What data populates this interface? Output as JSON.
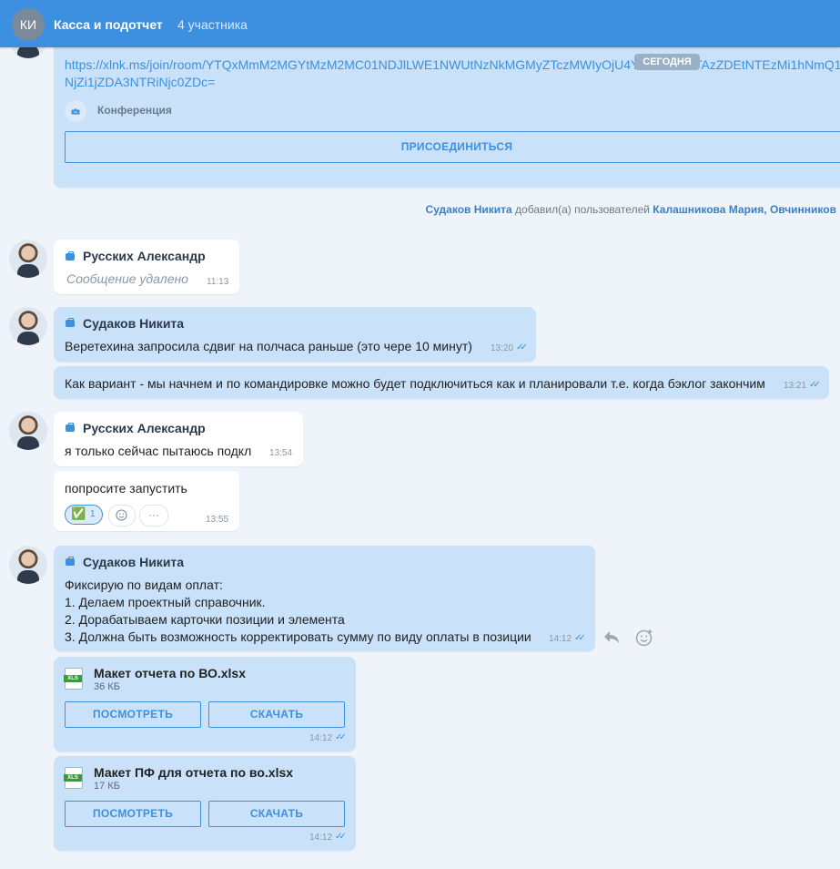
{
  "header": {
    "avatar_initials": "КИ",
    "title": "Касса и подотчет",
    "members": "4 участника"
  },
  "conference_message": {
    "link_line1": "https://xlnk.ms/join/room/YTQxMmM2MGYtMzM2MC01NDJlLWE1NWUtNzNkMGMyZTczMWIyOjU4Y",
    "link_line1_end": "TAzZDEtNTEzMi1hNmQ1",
    "link_line2": "NjZi1jZDA3NTRiNjc0ZDc=",
    "date_badge": "СЕГОДНЯ",
    "conference_label": "Конференция",
    "join_button": "ПРИСОЕДИНИТЬСЯ"
  },
  "system_message": {
    "actor": "Судаков Никита",
    "action": " добавил(а) пользователей ",
    "targets": "Калашникова Мария, Овчинников"
  },
  "messages": [
    {
      "author": "Русских Александр",
      "text": "Сообщение удалено",
      "time": "11:13"
    },
    {
      "author": "Судаков Никита",
      "text": "Веретехина запросила сдвиг на полчаса раньше (это чере 10 минут)",
      "time": "13:20"
    },
    {
      "text": "Как вариант - мы начнем и по командировке можно будет подключиться как и планировали т.е. когда бэклог закончим",
      "time": "13:21"
    },
    {
      "author": "Русских Александр",
      "text": "я только сейчас пытаюсь подкл",
      "time": "13:54"
    },
    {
      "text": "попросите запустить",
      "time": "13:55",
      "reaction_count": "1"
    },
    {
      "author": "Судаков Никита",
      "lines": [
        "Фиксирую по видам оплат:",
        "1. Делаем проектный справочник.",
        "2. Дорабатываем карточки позиции и элемента",
        "3. Должна быть возможность корректировать сумму по виду оплаты в позиции"
      ],
      "time": "14:12"
    }
  ],
  "files": [
    {
      "name": "Макет отчета по ВО.xlsx",
      "size": "36 КБ",
      "view": "ПОСМОТРЕТЬ",
      "download": "СКАЧАТЬ",
      "time": "14:12"
    },
    {
      "name": "Макет ПФ для отчета по во.xlsx",
      "size": "17 КБ",
      "view": "ПОСМОТРЕТЬ",
      "download": "СКАЧАТЬ",
      "time": "14:12"
    }
  ],
  "read_check": "✓✓",
  "reaction_emoji": "✅",
  "more_dots": "···",
  "icons": {
    "reply": "reply-icon",
    "smile": "smile-icon",
    "briefcase": "briefcase-icon",
    "file": "xls-file-icon"
  }
}
